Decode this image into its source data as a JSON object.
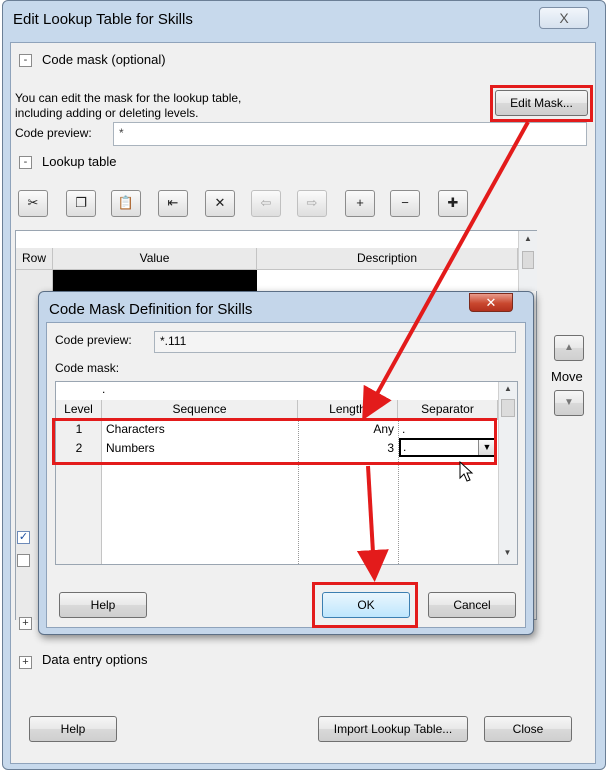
{
  "main_window": {
    "title": "Edit Lookup Table for Skills",
    "close_glyph": "X",
    "code_mask_section": {
      "toggle": "-",
      "title": "Code mask (optional)",
      "description_line1": "You can edit the mask for the lookup table,",
      "description_line2": "including adding or deleting levels.",
      "edit_mask_button": "Edit Mask...",
      "code_preview_label": "Code preview:",
      "code_preview_value": "*"
    },
    "lookup_table_section": {
      "toggle": "-",
      "title": "Lookup table",
      "toolbar": [
        {
          "name": "cut-icon",
          "glyph": "✂",
          "enabled": true
        },
        {
          "name": "copy-icon",
          "glyph": "❐",
          "enabled": true
        },
        {
          "name": "paste-icon",
          "glyph": "📋",
          "enabled": true
        },
        {
          "name": "insert-row-icon",
          "glyph": "⇤",
          "enabled": true
        },
        {
          "name": "delete-row-icon",
          "glyph": "✕",
          "enabled": true
        },
        {
          "name": "outdent-icon",
          "glyph": "⇦",
          "enabled": false
        },
        {
          "name": "indent-icon",
          "glyph": "⇨",
          "enabled": false
        },
        {
          "name": "expand-icon",
          "glyph": "+",
          "enabled": true
        },
        {
          "name": "collapse-icon",
          "glyph": "−",
          "enabled": true
        },
        {
          "name": "expand-all-icon",
          "glyph": "✚",
          "enabled": true
        }
      ],
      "columns": [
        "Row",
        "Value",
        "Description"
      ],
      "move_label": "Move",
      "move_up_glyph": "▲",
      "move_down_glyph": "▼"
    },
    "data_entry_section": {
      "toggle": "+",
      "title": "Data entry options"
    },
    "collapsed_toggle": "+",
    "help_button": "Help",
    "import_button": "Import Lookup Table...",
    "close_button": "Close"
  },
  "dialog": {
    "title": "Code Mask Definition for Skills",
    "close_glyph": "✕",
    "code_preview_label": "Code preview:",
    "code_preview_value": "*.111",
    "code_mask_label": "Code mask:",
    "top_row_marker": ".",
    "columns": [
      "Level",
      "Sequence",
      "Length",
      "Separator"
    ],
    "rows": [
      {
        "level": "1",
        "sequence": "Characters",
        "length": "Any",
        "separator": "."
      },
      {
        "level": "2",
        "sequence": "Numbers",
        "length": "3",
        "separator": "."
      }
    ],
    "help_button": "Help",
    "ok_button": "OK",
    "cancel_button": "Cancel"
  },
  "annotation_color": "#e31b1b"
}
